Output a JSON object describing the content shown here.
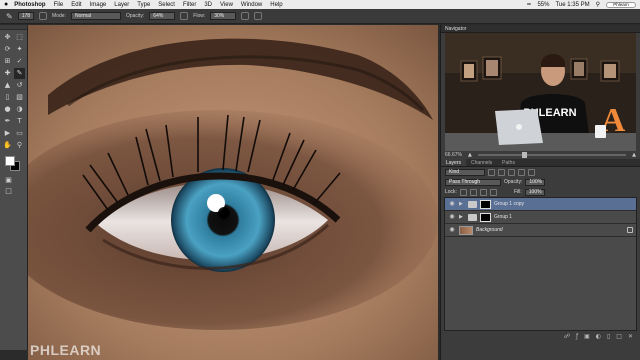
{
  "menubar": {
    "apple": "",
    "app": "Photoshop",
    "items": [
      "File",
      "Edit",
      "Image",
      "Layer",
      "Type",
      "Select",
      "Filter",
      "3D",
      "View",
      "Window",
      "Help"
    ],
    "battery": "55%",
    "time": "Tue 1:35 PM",
    "search": "Phlearn"
  },
  "options": {
    "brush_size": "178",
    "mode_label": "Mode:",
    "mode_value": "Normal",
    "opacity_label": "Opacity:",
    "opacity_value": "64%",
    "flow_label": "Flow:",
    "flow_value": "30%"
  },
  "canvas": {
    "watermark": "PHLEARN"
  },
  "navigator": {
    "title": "Navigator",
    "zoom": "66.67%",
    "shirt_text": "PHLEARN",
    "sign_letter": "A"
  },
  "layers_panel": {
    "tabs": [
      "Layers",
      "Channels",
      "Paths"
    ],
    "active_tab": "Layers",
    "filter": "Kind",
    "blend_mode": "Pass Through",
    "opacity_label": "Opacity:",
    "opacity_value": "100%",
    "lock_label": "Lock:",
    "fill_label": "Fill:",
    "fill_value": "100%",
    "layers": [
      {
        "name": "Group 1 copy",
        "selected": true
      },
      {
        "name": "Group 1",
        "selected": false
      },
      {
        "name": "Background",
        "selected": false
      }
    ]
  },
  "colors": {
    "selection": "#5a6f94",
    "iris": "#3c8fb0",
    "skin": "#a67c5e"
  }
}
